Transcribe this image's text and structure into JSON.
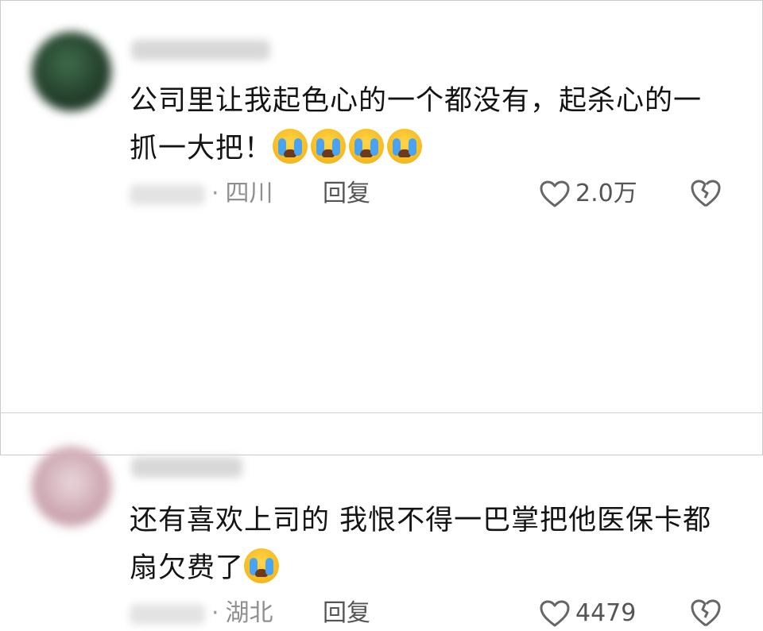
{
  "comments": [
    {
      "text": "公司里让我起色心的一个都没有，起杀心的一抓一大把！",
      "emoji_count": 4,
      "location": "四川",
      "reply_label": "回复",
      "likes": "2.0万"
    },
    {
      "text": "还有喜欢上司的 我恨不得一巴掌把他医保卡都扇欠费了",
      "emoji_count": 1,
      "location": "湖北",
      "reply_label": "回复",
      "likes": "4479"
    }
  ],
  "icons": {
    "like": "heart-outline-icon",
    "dislike": "broken-heart-icon",
    "emoji": "loudly-crying-face-emoji"
  },
  "colors": {
    "text": "#141414",
    "meta": "#8a8a8a",
    "emoji_yellow": "#f6b91e",
    "tear_blue": "#4aa3f0"
  }
}
